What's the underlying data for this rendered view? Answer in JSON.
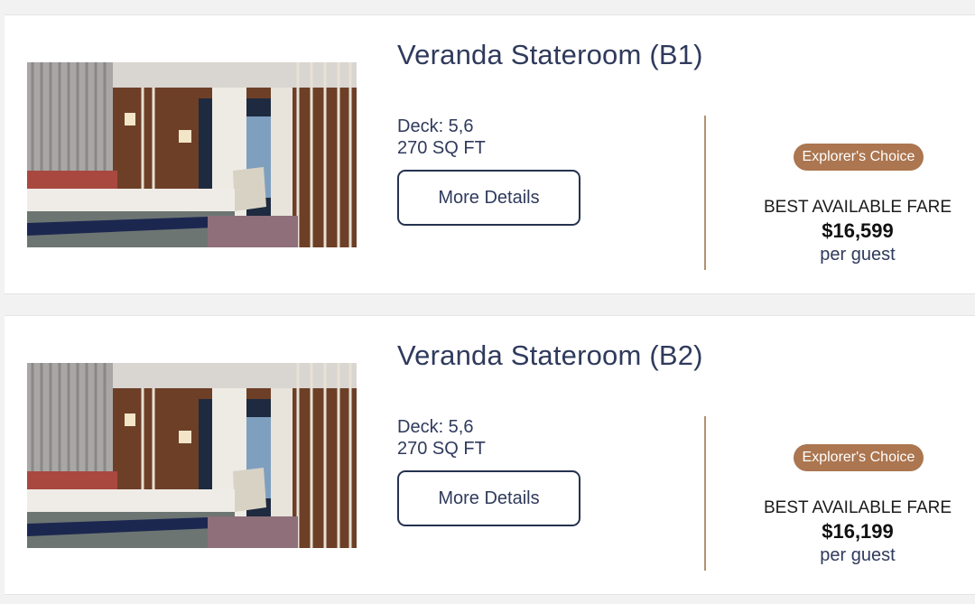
{
  "staterooms": [
    {
      "title": "Veranda Stateroom (B1)",
      "deck": "Deck: 5,6",
      "size": "270 SQ FT",
      "details_label": "More Details",
      "badge": "Explorer's Choice",
      "fare_label": "BEST AVAILABLE FARE",
      "price": "$16,599",
      "price_unit": "per guest"
    },
    {
      "title": "Veranda Stateroom (B2)",
      "deck": "Deck: 5,6",
      "size": "270 SQ FT",
      "details_label": "More Details",
      "badge": "Explorer's Choice",
      "fare_label": "BEST AVAILABLE FARE",
      "price": "$16,199",
      "price_unit": "per guest"
    }
  ],
  "colors": {
    "title_navy": "#2f3a5c",
    "button_border": "#25324f",
    "divider_tan": "#b3916d",
    "badge_brown": "#ab7650"
  }
}
